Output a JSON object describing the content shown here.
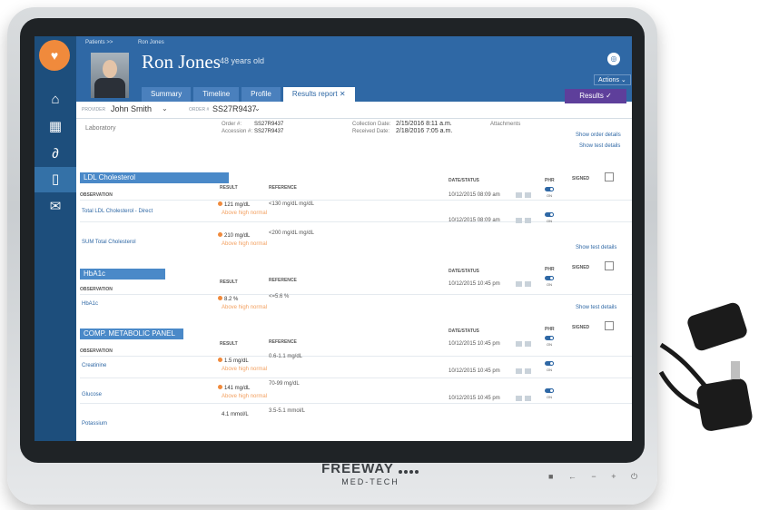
{
  "header": {
    "breadcrumb_1": "Patients >>",
    "breadcrumb_2": "Ron Jones",
    "patient_name": "Ron Jones",
    "age": "48 years old",
    "actions_label": "Actions ⌄",
    "tabs": [
      "Summary",
      "Timeline",
      "Profile",
      "Results report ✕"
    ],
    "results_button": "Results ✓"
  },
  "provider_bar": {
    "provider_label": "PROVIDER",
    "provider_value": "John Smith",
    "order_label": "ORDER #",
    "order_value": "SS27R9437"
  },
  "info": {
    "laboratory": "Laboratory",
    "order_k": "Order #:",
    "order_v": "SS27R9437",
    "accession_k": "Accession #:",
    "accession_v": "SS27R9437",
    "collection_k": "Collection Date:",
    "collection_v": "2/15/2016 8:11 a.m.",
    "received_k": "Received Date:",
    "received_v": "2/18/2016 7:05 a.m.",
    "attachments": "Attachments",
    "show_order": "Show order details",
    "show_test": "Show test details"
  },
  "columns": {
    "observation": "OBSERVATION",
    "result": "RESULT",
    "reference": "REFERENCE",
    "datestatus": "DATE/STATUS",
    "phr": "PHR",
    "signed": "SIGNED",
    "on": "ON",
    "show_test": "Show test details"
  },
  "panels": {
    "ldl": {
      "title": "LDL Cholesterol",
      "rows": [
        {
          "name": "Total LDL Cholesterol - Direct",
          "result": "121 mg/dL",
          "flag": "Above high normal",
          "reference": "<130 mg/dL mg/dL",
          "date": "10/12/2015 08:09 am"
        },
        {
          "name": "SUM Total Cholesterol",
          "result": "210 mg/dL",
          "flag": "Above high normal",
          "reference": "<200 mg/dL mg/dL",
          "date": "10/12/2015 08:09 am"
        }
      ]
    },
    "hba1c": {
      "title": "HbA1c",
      "rows": [
        {
          "name": "HbA1c",
          "result": "8.2 %",
          "flag": "Above high normal",
          "reference": "<=5.6 %",
          "date": "10/12/2015 10:45 pm"
        }
      ]
    },
    "cmp": {
      "title": "COMP. METABOLIC PANEL",
      "rows": [
        {
          "name": "Creatinine",
          "result": "1.5 mg/dL",
          "flag": "Above high normal",
          "reference": "0.6-1.1 mg/dL",
          "date": "10/12/2015 10:45 pm"
        },
        {
          "name": "Glucose",
          "result": "141 mg/dL",
          "flag": "Above high normal",
          "reference": "70-99 mg/dL",
          "date": "10/12/2015 10:45 pm"
        },
        {
          "name": "Potassium",
          "result": "4.1 mmol/L",
          "flag": "",
          "reference": "3.5-5.1 mmol/L",
          "date": "10/12/2015 10:45 pm"
        }
      ]
    }
  },
  "device": {
    "brand": "FREEWAY",
    "sub": "MED-TECH"
  }
}
